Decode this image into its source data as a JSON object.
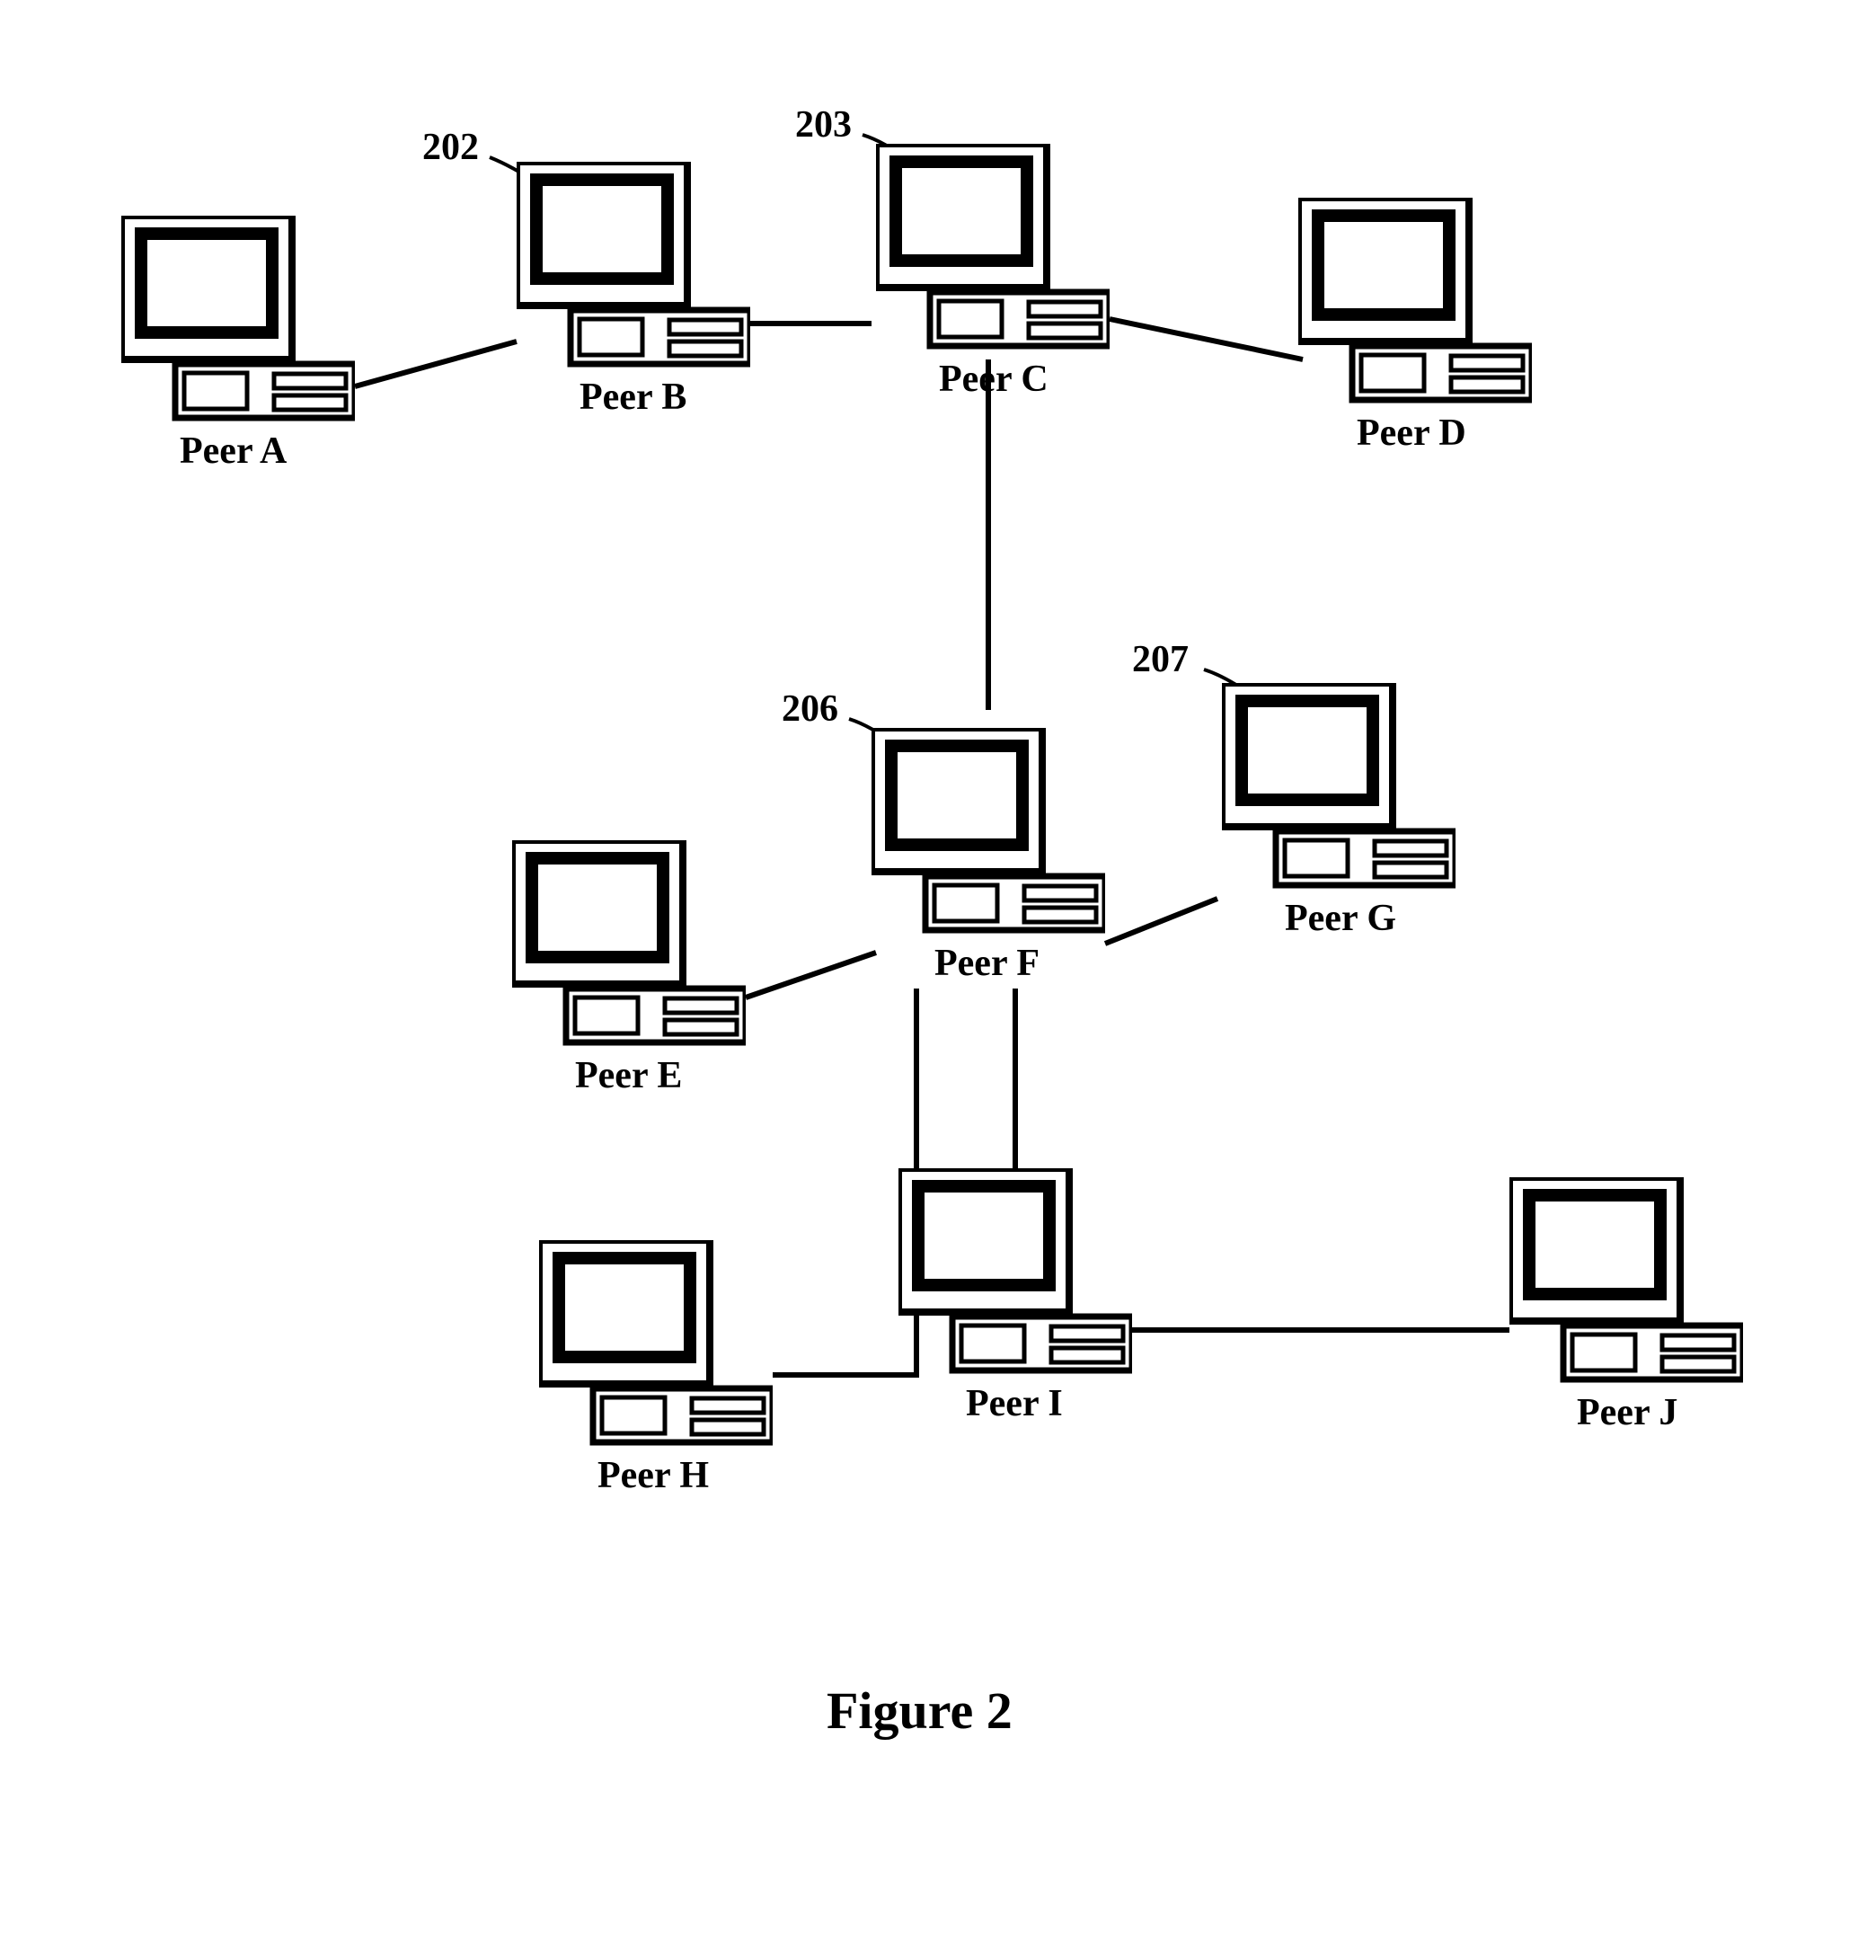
{
  "figure_label": "Figure 2",
  "peers": {
    "A": {
      "label": "Peer A",
      "ref": ""
    },
    "B": {
      "label": "Peer B",
      "ref": "202"
    },
    "C": {
      "label": "Peer C",
      "ref": "203"
    },
    "D": {
      "label": "Peer D",
      "ref": ""
    },
    "E": {
      "label": "Peer E",
      "ref": ""
    },
    "F": {
      "label": "Peer F",
      "ref": "206"
    },
    "G": {
      "label": "Peer G",
      "ref": "207"
    },
    "H": {
      "label": "Peer H",
      "ref": ""
    },
    "I": {
      "label": "Peer I",
      "ref": ""
    },
    "J": {
      "label": "Peer J",
      "ref": ""
    }
  },
  "edges": [
    [
      "A",
      "B"
    ],
    [
      "B",
      "C"
    ],
    [
      "C",
      "D"
    ],
    [
      "C",
      "F"
    ],
    [
      "F",
      "E"
    ],
    [
      "F",
      "G"
    ],
    [
      "F",
      "H"
    ],
    [
      "F",
      "I"
    ],
    [
      "I",
      "J"
    ]
  ]
}
